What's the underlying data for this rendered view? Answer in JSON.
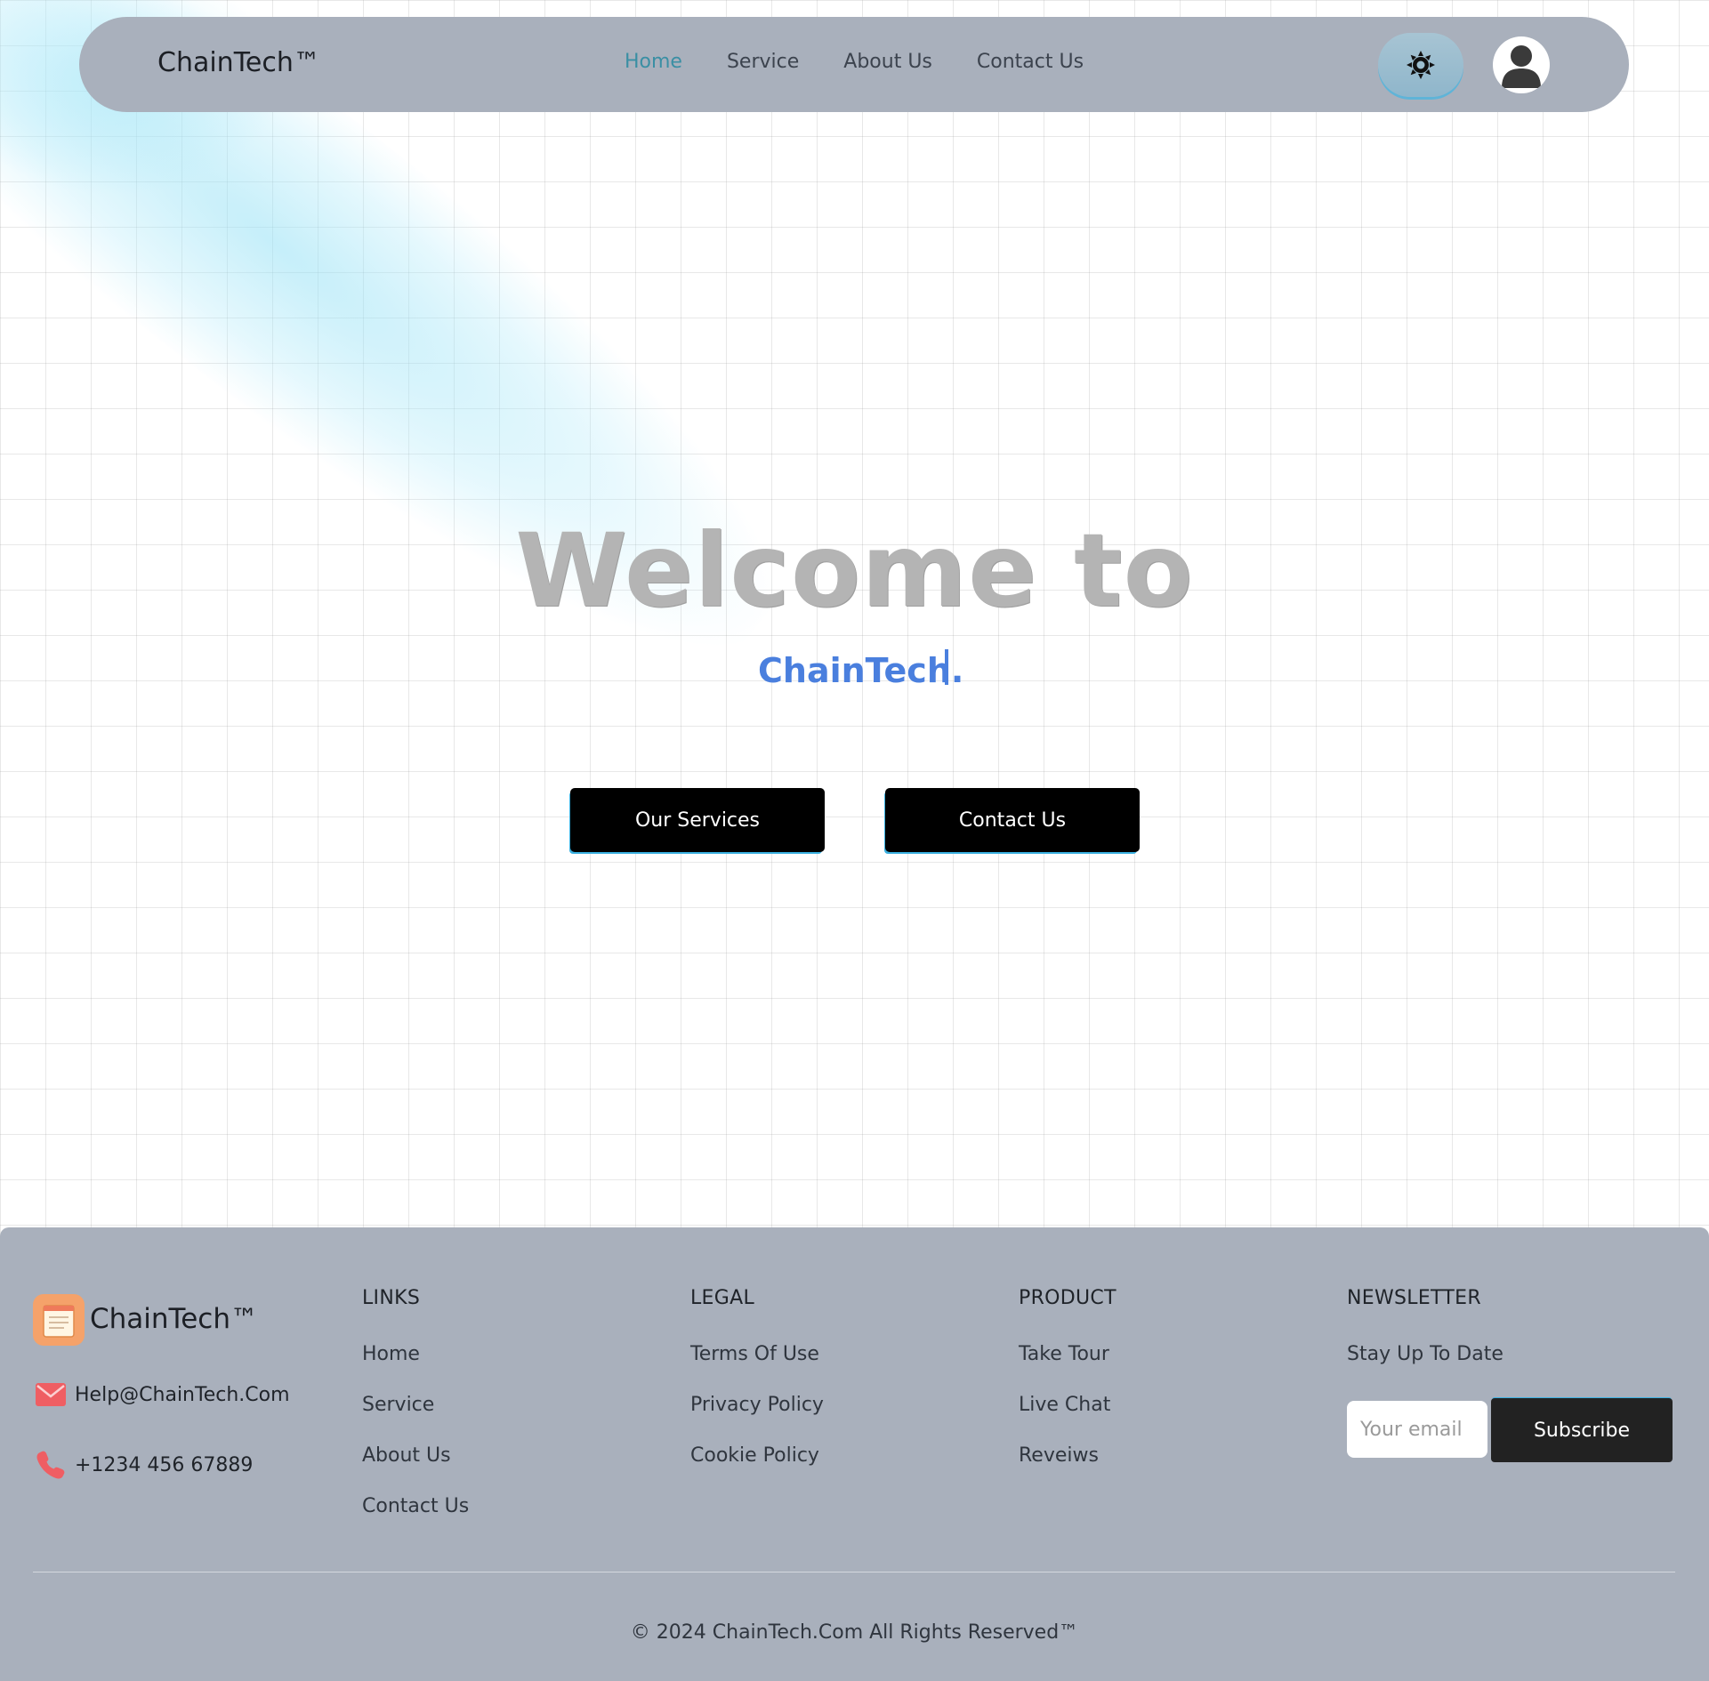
{
  "navbar": {
    "brand": "ChainTech™",
    "links": [
      {
        "label": "Home",
        "active": true
      },
      {
        "label": "Service",
        "active": false
      },
      {
        "label": "About Us",
        "active": false
      },
      {
        "label": "Contact Us",
        "active": false
      }
    ],
    "theme_toggle_icon": "sun-icon",
    "avatar_icon": "user-avatar-icon",
    "accent_color": "#3a8fa4",
    "bg_color": "#a9b0bc"
  },
  "hero": {
    "title": "Welcome to",
    "subtitle": "ChainTech.",
    "subtitle_color": "#4a7fde",
    "buttons": {
      "services": "Our Services",
      "contact": "Contact Us"
    }
  },
  "footer": {
    "brand": "ChainTech™",
    "logo_icon": "notepad-icon",
    "email_icon": "mail-icon",
    "email": "Help@ChainTech.Com",
    "phone_icon": "phone-icon",
    "phone": "+1234 456 67889",
    "links": {
      "heading": "LINKS",
      "items": [
        "Home",
        "Service",
        "About Us",
        "Contact Us"
      ]
    },
    "legal": {
      "heading": "LEGAL",
      "items": [
        "Terms Of Use",
        "Privacy Policy",
        "Cookie Policy"
      ]
    },
    "product": {
      "heading": "PRODUCT",
      "items": [
        "Take Tour",
        "Live Chat",
        "Reveiws"
      ]
    },
    "newsletter": {
      "heading": "NEWSLETTER",
      "text": "Stay Up To Date",
      "placeholder": "Your email",
      "button": "Subscribe"
    },
    "copyright": "© 2024 ChainTech.Com All Rights Reserved™"
  }
}
